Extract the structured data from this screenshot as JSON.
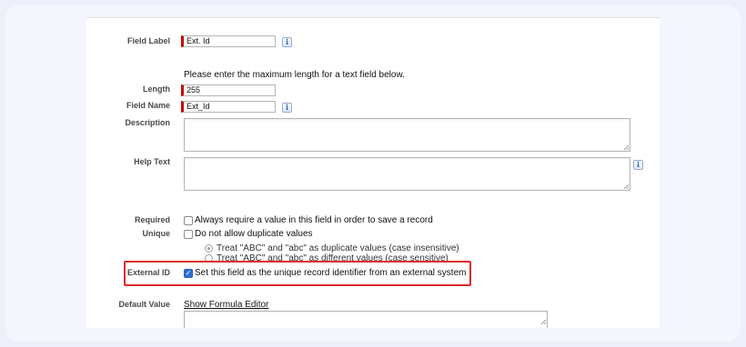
{
  "form": {
    "field_label": {
      "label": "Field Label",
      "value": "Ext. Id"
    },
    "max_length_hint": "Please enter the maximum length for a text field below.",
    "length": {
      "label": "Length",
      "value": "255"
    },
    "field_name": {
      "label": "Field Name",
      "value": "Ext_Id"
    },
    "description": {
      "label": "Description",
      "value": ""
    },
    "help_text": {
      "label": "Help Text",
      "value": ""
    },
    "required": {
      "label": "Required",
      "option": "Always require a value in this field in order to save a record",
      "checked": false
    },
    "unique": {
      "label": "Unique",
      "option": "Do not allow duplicate values",
      "checked": false,
      "radio_insensitive": "Treat \"ABC\" and \"abc\" as duplicate values (case insensitive)",
      "radio_sensitive": "Treat \"ABC\" and \"abc\" as different values (case sensitive)"
    },
    "external_id": {
      "label": "External ID",
      "option": "Set this field as the unique record identifier from an external system",
      "checked": true
    },
    "default_value": {
      "label": "Default Value",
      "link": "Show Formula Editor",
      "value": ""
    }
  },
  "icons": {
    "info": "i",
    "check": "✓"
  },
  "colors": {
    "required_marker": "#cc0000",
    "highlight_border": "#e0292d",
    "checkbox_checked": "#2f6fd6"
  }
}
